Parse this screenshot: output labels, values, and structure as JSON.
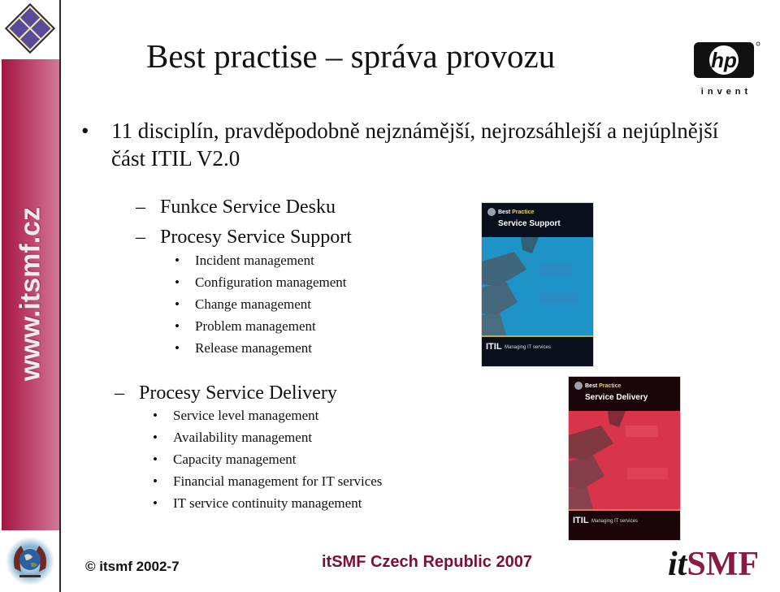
{
  "slide": {
    "title": "Best practise – správa provozu",
    "sidebar_url": "www.itsmf.cz",
    "hp_logo_text": "invent",
    "hp_logo_mark": "hp"
  },
  "content": {
    "main_bullet": "11 disciplín, pravděpodobně nejznámější, nejrozsáhlejší a nejúplnější část ITIL V2.0",
    "bullet_glyph": "•",
    "dash_glyph": "–",
    "service_desk": "Funkce Service Desku",
    "service_support": {
      "heading": "Procesy Service Support",
      "items": [
        "Incident management",
        "Configuration management",
        "Change management",
        "Problem management",
        "Release management"
      ]
    },
    "service_delivery": {
      "heading": "Procesy Service Delivery",
      "items": [
        "Service level management",
        "Availability management",
        "Capacity management",
        "Financial management for IT services",
        "IT service continuity management"
      ]
    }
  },
  "books": [
    {
      "brand_best": "Best",
      "brand_practice": "Practice",
      "title": "Service Support",
      "series": "ITIL",
      "tagline": "Managing IT services",
      "color": "#1e93c8"
    },
    {
      "brand_best": "Best",
      "brand_practice": "Practice",
      "title": "Service Delivery",
      "series": "ITIL",
      "tagline": "Managing IT services",
      "color": "#d8344a"
    }
  ],
  "footer": {
    "copyright": "© itsmf 2002-7",
    "center": "itSMF Czech Republic 2007",
    "logo_it": "it",
    "logo_smf": "SMF"
  },
  "colors": {
    "sidebar": "#b3305a",
    "footer_accent": "#7a1038",
    "logo_diamond": "#5a4a9a"
  }
}
